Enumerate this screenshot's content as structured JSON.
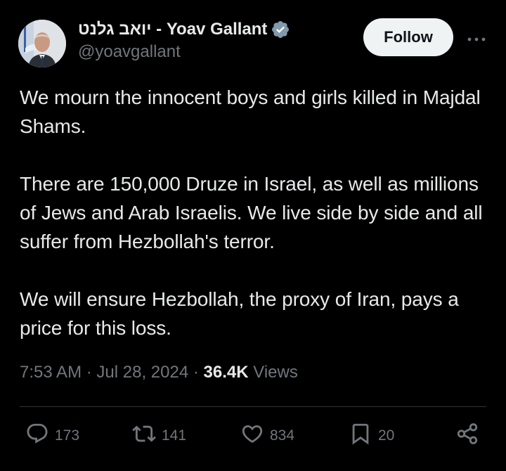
{
  "author": {
    "display_name": "יואב גלנט - Yoav Gallant",
    "handle": "@yoavgallant",
    "verified_icon": "verified-badge-icon",
    "avatar_icon": "avatar"
  },
  "follow_label": "Follow",
  "more_icon": "more-horizontal-icon",
  "tweet": {
    "paragraphs": [
      "We mourn the innocent boys and girls killed in Majdal Shams.",
      "There are 150,000 Druze in Israel, as well as millions of Jews and Arab Israelis. We live side by side and all suffer from Hezbollah's terror.",
      "We will ensure Hezbollah, the proxy of Iran, pays a price for this loss."
    ]
  },
  "meta": {
    "time": "7:53 AM",
    "separator": "·",
    "date": "Jul 28, 2024",
    "views_count": "36.4K",
    "views_label": "Views"
  },
  "actions": {
    "reply": {
      "icon": "reply-icon",
      "count": "173"
    },
    "repost": {
      "icon": "repost-icon",
      "count": "141"
    },
    "like": {
      "icon": "like-icon",
      "count": "834"
    },
    "bookmark": {
      "icon": "bookmark-icon",
      "count": "20"
    },
    "share": {
      "icon": "share-icon"
    }
  },
  "colors": {
    "background": "#000000",
    "text_primary": "#e7e9ea",
    "text_secondary": "#71767b",
    "verified_badge": "#829aab",
    "divider": "#2f3336",
    "follow_button_bg": "#eff3f4"
  }
}
